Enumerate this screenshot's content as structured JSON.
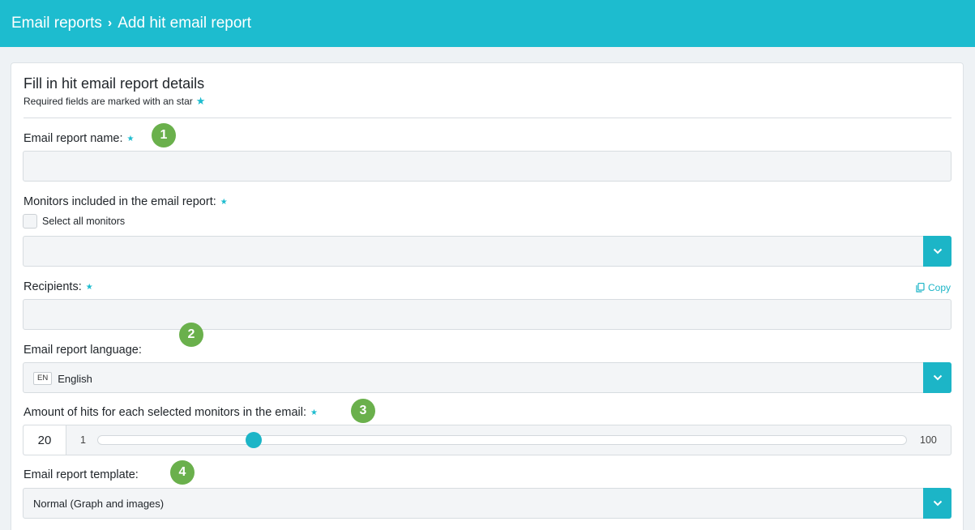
{
  "header": {
    "breadcrumb_parent": "Email reports",
    "breadcrumb_sep": "›",
    "breadcrumb_current": "Add hit email report"
  },
  "form": {
    "title": "Fill in hit email report details",
    "subtitle": "Required fields are marked with an star",
    "required_star": "★",
    "fields": {
      "name": {
        "label": "Email report name:",
        "value": ""
      },
      "monitors": {
        "label": "Monitors included in the email report:",
        "select_all_label": "Select all monitors",
        "select_all_checked": false,
        "value": ""
      },
      "recipients": {
        "label": "Recipients:",
        "copy_label": "Copy",
        "value": ""
      },
      "language": {
        "label": "Email report language:",
        "code": "EN",
        "value": "English"
      },
      "hits": {
        "label": "Amount of hits for each selected monitors in the email:",
        "value": "20",
        "min": "1",
        "max": "100",
        "fraction": 0.193
      },
      "template": {
        "label": "Email report template:",
        "value": "Normal (Graph and images)"
      }
    }
  },
  "annotations": [
    "1",
    "2",
    "3",
    "4"
  ],
  "colors": {
    "accent": "#1dbccf",
    "badge": "#6ab04c"
  }
}
